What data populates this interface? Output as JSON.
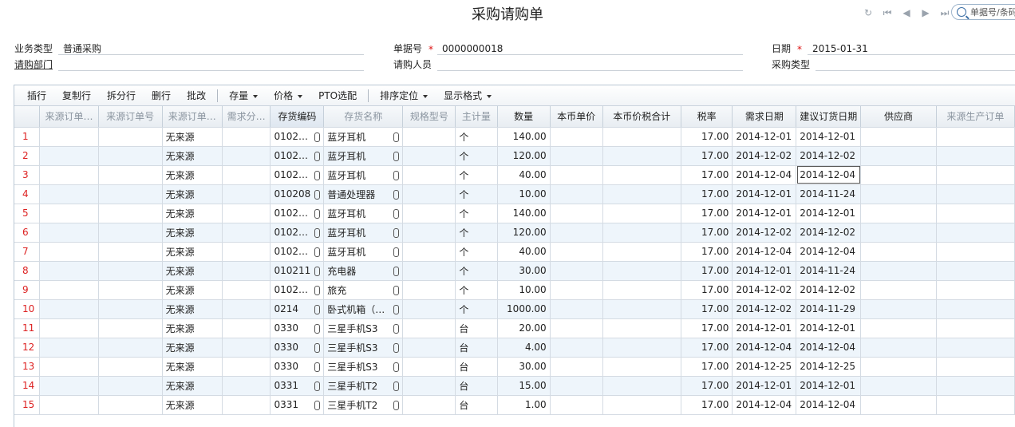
{
  "header": {
    "title": "采购请购单",
    "search_placeholder": "单据号/条码"
  },
  "nav_icons": [
    "refresh-icon",
    "first-record-icon",
    "previous-record-icon",
    "next-record-icon",
    "last-record-icon"
  ],
  "form": {
    "biz_type_label": "业务类型",
    "biz_type_value": "普通采购",
    "doc_no_label": "单据号",
    "doc_no_value": "0000000018",
    "date_label": "日期",
    "date_value": "2015-01-31",
    "dept_label": "请购部门",
    "dept_value": "",
    "requester_label": "请购人员",
    "requester_value": "",
    "purchase_type_label": "采购类型",
    "purchase_type_value": "",
    "required_mark": "*"
  },
  "toolbar": {
    "insert_row": "插行",
    "copy_row": "复制行",
    "split_row": "拆分行",
    "delete_row": "删行",
    "batch_edit": "批改",
    "inventory": "存量",
    "price": "价格",
    "pto_select": "PTO选配",
    "sort_locate": "排序定位",
    "display_format": "显示格式"
  },
  "columns": [
    "来源订单…",
    "来源订单号",
    "来源订单…",
    "需求分…",
    "存货编码",
    "存货名称",
    "规格型号",
    "主计量",
    "数量",
    "本币单价",
    "本币价税合计",
    "税率",
    "需求日期",
    "建议订货日期",
    "供应商",
    "来源生产订单"
  ],
  "rows": [
    {
      "no": "1",
      "src": "无来源",
      "code": "0102…",
      "name": "蓝牙耳机",
      "unit": "个",
      "qty": "140.00",
      "tax": "17.00",
      "req_date": "2014-12-01",
      "sug_date": "2014-12-01"
    },
    {
      "no": "2",
      "src": "无来源",
      "code": "0102…",
      "name": "蓝牙耳机",
      "unit": "个",
      "qty": "120.00",
      "tax": "17.00",
      "req_date": "2014-12-02",
      "sug_date": "2014-12-02"
    },
    {
      "no": "3",
      "src": "无来源",
      "code": "0102…",
      "name": "蓝牙耳机",
      "unit": "个",
      "qty": "40.00",
      "tax": "17.00",
      "req_date": "2014-12-04",
      "sug_date": "2014-12-04"
    },
    {
      "no": "4",
      "src": "无来源",
      "code": "010208",
      "name": "普通处理器",
      "unit": "个",
      "qty": "10.00",
      "tax": "17.00",
      "req_date": "2014-12-01",
      "sug_date": "2014-11-24"
    },
    {
      "no": "5",
      "src": "无来源",
      "code": "0102…",
      "name": "蓝牙耳机",
      "unit": "个",
      "qty": "140.00",
      "tax": "17.00",
      "req_date": "2014-12-01",
      "sug_date": "2014-12-01"
    },
    {
      "no": "6",
      "src": "无来源",
      "code": "0102…",
      "name": "蓝牙耳机",
      "unit": "个",
      "qty": "120.00",
      "tax": "17.00",
      "req_date": "2014-12-02",
      "sug_date": "2014-12-02"
    },
    {
      "no": "7",
      "src": "无来源",
      "code": "0102…",
      "name": "蓝牙耳机",
      "unit": "个",
      "qty": "40.00",
      "tax": "17.00",
      "req_date": "2014-12-04",
      "sug_date": "2014-12-04"
    },
    {
      "no": "8",
      "src": "无来源",
      "code": "010211",
      "name": "充电器",
      "unit": "个",
      "qty": "30.00",
      "tax": "17.00",
      "req_date": "2014-12-01",
      "sug_date": "2014-11-24"
    },
    {
      "no": "9",
      "src": "无来源",
      "code": "0102…",
      "name": "旅充",
      "unit": "个",
      "qty": "10.00",
      "tax": "17.00",
      "req_date": "2014-12-02",
      "sug_date": "2014-12-02"
    },
    {
      "no": "10",
      "src": "无来源",
      "code": "0214",
      "name": "卧式机箱（…",
      "unit": "个",
      "qty": "1000.00",
      "tax": "17.00",
      "req_date": "2014-12-02",
      "sug_date": "2014-11-29"
    },
    {
      "no": "11",
      "src": "无来源",
      "code": "0330",
      "name": "三星手机S3",
      "unit": "台",
      "qty": "20.00",
      "tax": "17.00",
      "req_date": "2014-12-01",
      "sug_date": "2014-12-01"
    },
    {
      "no": "12",
      "src": "无来源",
      "code": "0330",
      "name": "三星手机S3",
      "unit": "台",
      "qty": "4.00",
      "tax": "17.00",
      "req_date": "2014-12-04",
      "sug_date": "2014-12-04"
    },
    {
      "no": "13",
      "src": "无来源",
      "code": "0330",
      "name": "三星手机S3",
      "unit": "台",
      "qty": "30.00",
      "tax": "17.00",
      "req_date": "2014-12-25",
      "sug_date": "2014-12-25"
    },
    {
      "no": "14",
      "src": "无来源",
      "code": "0331",
      "name": "三星手机T2",
      "unit": "台",
      "qty": "15.00",
      "tax": "17.00",
      "req_date": "2014-12-01",
      "sug_date": "2014-12-01"
    },
    {
      "no": "15",
      "src": "无来源",
      "code": "0331",
      "name": "三星手机T2",
      "unit": "台",
      "qty": "1.00",
      "tax": "17.00",
      "req_date": "2014-12-04",
      "sug_date": "2014-12-04"
    }
  ],
  "colors": {
    "row_alt": "#eef5fb",
    "row_number": "#dd2222",
    "required": "#dd1111"
  }
}
